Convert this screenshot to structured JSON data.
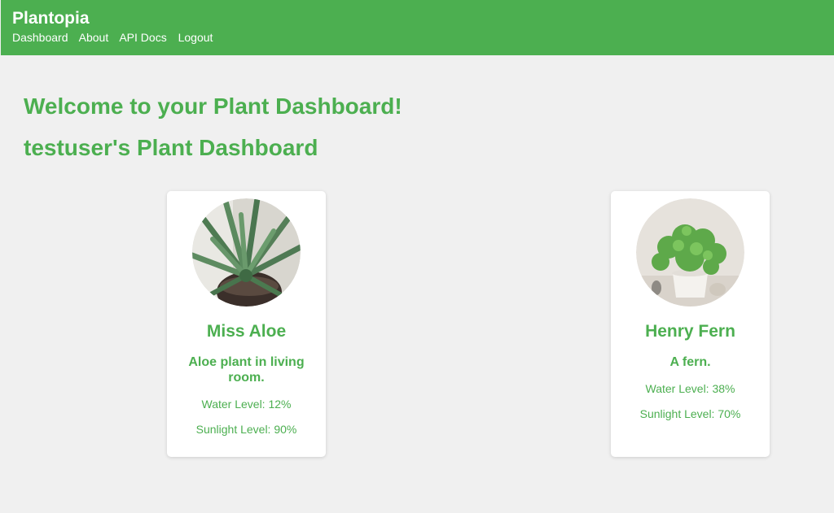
{
  "header": {
    "brand": "Plantopia",
    "nav": [
      "Dashboard",
      "About",
      "API Docs",
      "Logout"
    ]
  },
  "main": {
    "welcome": "Welcome to your Plant Dashboard!",
    "user_heading": "testuser's Plant Dashboard"
  },
  "plants": [
    {
      "name": "Miss Aloe",
      "description": "Aloe plant in living room.",
      "water": "Water Level: 12%",
      "sunlight": "Sunlight Level: 90%",
      "image": "aloe-plant-photo"
    },
    {
      "name": "Henry Fern",
      "description": "A fern.",
      "water": "Water Level: 38%",
      "sunlight": "Sunlight Level: 70%",
      "image": "fern-plant-photo"
    }
  ],
  "colors": {
    "accent": "#4caf50",
    "background": "#f0f0f0",
    "card": "#ffffff"
  }
}
